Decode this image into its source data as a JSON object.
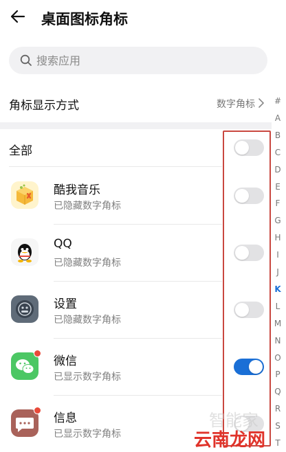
{
  "header": {
    "title": "桌面图标角标"
  },
  "search": {
    "placeholder": "搜索应用"
  },
  "display_mode": {
    "label": "角标显示方式",
    "value": "数字角标"
  },
  "all_toggle": {
    "label": "全部",
    "on": false
  },
  "apps": [
    {
      "name": "酷我音乐",
      "status": "已隐藏数字角标",
      "on": false,
      "icon": "kuwo-music-icon",
      "badge": false
    },
    {
      "name": "QQ",
      "status": "已隐藏数字角标",
      "on": false,
      "icon": "qq-penguin-icon",
      "badge": false
    },
    {
      "name": "设置",
      "status": "已隐藏数字角标",
      "on": false,
      "icon": "settings-gear-icon",
      "badge": false
    },
    {
      "name": "微信",
      "status": "已显示数字角标",
      "on": true,
      "icon": "wechat-icon",
      "badge": true
    },
    {
      "name": "信息",
      "status": "已显示数字角标",
      "on": false,
      "icon": "messages-icon",
      "badge": true
    }
  ],
  "alpha_index": {
    "letters": [
      "#",
      "A",
      "B",
      "C",
      "D",
      "E",
      "F",
      "G",
      "H",
      "I",
      "J",
      "K",
      "L",
      "M",
      "N",
      "O",
      "P",
      "Q",
      "R",
      "S",
      "T"
    ],
    "active": "K"
  },
  "watermark": {
    "text": "云南龙网",
    "ghost": "智能家"
  },
  "colors": {
    "accent": "#1a6fd6",
    "toggle_off": "#e2e2e4",
    "highlight_box": "#c9473f",
    "badge": "#e84a3a",
    "watermark": "#e0332a"
  }
}
